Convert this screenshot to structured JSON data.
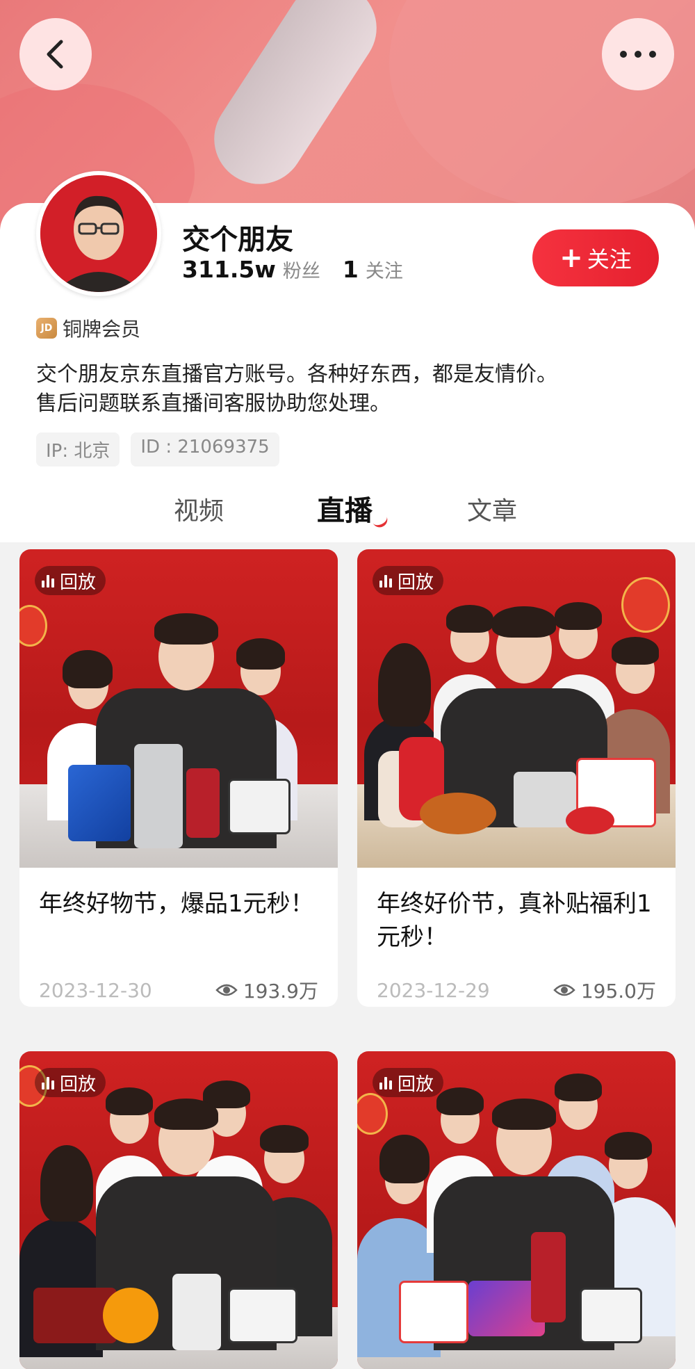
{
  "profile": {
    "name": "交个朋友",
    "fans_count": "311.5w",
    "fans_label": "粉丝",
    "following_count": "1",
    "following_label": "关注",
    "follow_button": "关注",
    "member_badge": "铜牌会员",
    "member_icon_text": "JD",
    "bio_line1": "交个朋友京东直播官方账号。各种好东西，都是友情价。",
    "bio_line2": "售后问题联系直播间客服协助您处理。",
    "ip": "IP: 北京",
    "id": "ID : 21069375"
  },
  "tabs": [
    {
      "label": "视频",
      "active": false
    },
    {
      "label": "直播",
      "active": true
    },
    {
      "label": "文章",
      "active": false
    }
  ],
  "cards": [
    {
      "badge": "回放",
      "title": "年终好物节，爆品1元秒！",
      "date": "2023-12-30",
      "views": "193.9万"
    },
    {
      "badge": "回放",
      "title": "年终好价节，真补贴福利1元秒！",
      "date": "2023-12-29",
      "views": "195.0万"
    },
    {
      "badge": "回放",
      "title": "",
      "date": "",
      "views": ""
    },
    {
      "badge": "回放",
      "title": "",
      "date": "",
      "views": ""
    }
  ],
  "colors": {
    "accent": "#e5202e",
    "banner": "#ef8a88"
  },
  "icons": {
    "back": "chevron-left-icon",
    "more": "more-dots-icon",
    "replay": "bars-icon",
    "views": "eye-icon"
  }
}
